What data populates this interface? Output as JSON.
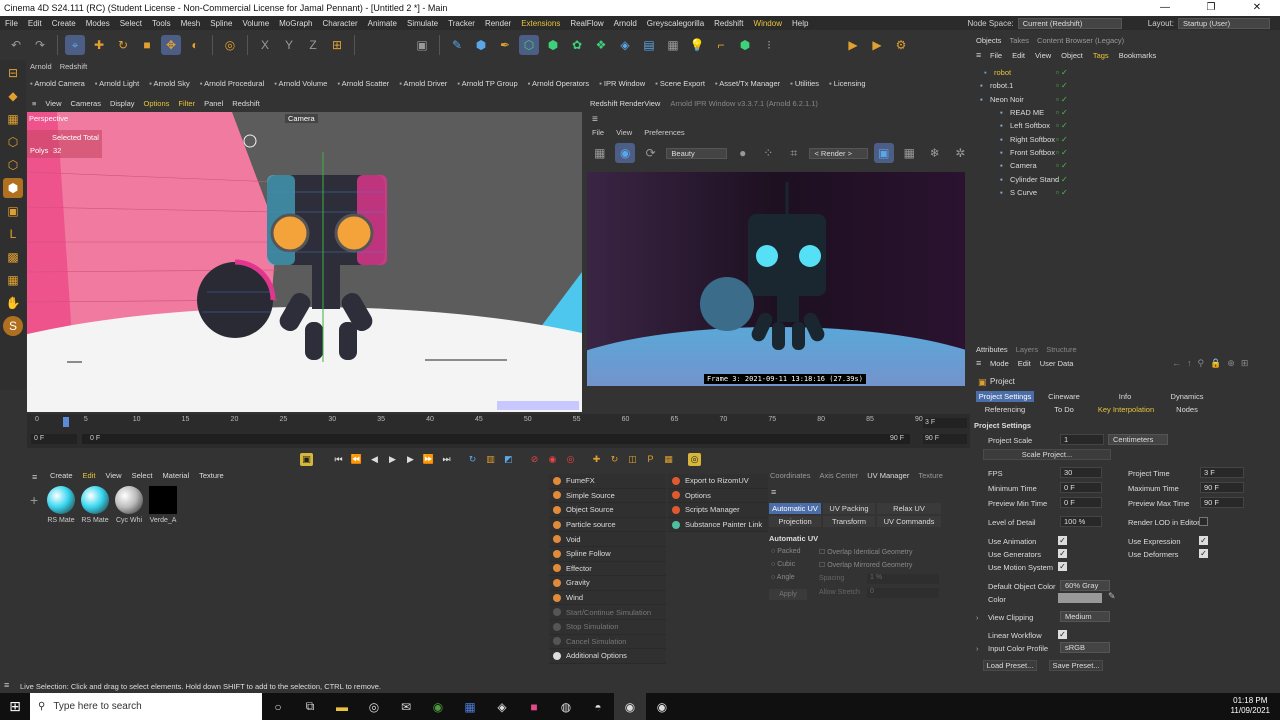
{
  "window": {
    "title": "Cinema 4D S24.111 (RC) (Student License - Non-Commercial License for Jamal Pennant) - [Untitled 2 *] - Main",
    "min": "—",
    "max": "❐",
    "close": "✕"
  },
  "menubar": {
    "items": [
      "File",
      "Edit",
      "Create",
      "Modes",
      "Select",
      "Tools",
      "Mesh",
      "Spline",
      "Volume",
      "MoGraph",
      "Character",
      "Animate",
      "Simulate",
      "Tracker",
      "Render",
      "Extensions",
      "RealFlow",
      "Arnold",
      "Greyscalegorilla",
      "Redshift",
      "Window",
      "Help"
    ],
    "node_space_label": "Node Space:",
    "node_space_value": "Current (Redshift)",
    "layout_label": "Layout:",
    "layout_value": "Startup (User)"
  },
  "arnold": {
    "tabs": [
      "Arnold",
      "Redshift"
    ],
    "items": [
      "Arnold Camera",
      "Arnold Light",
      "Arnold Sky",
      "Arnold Procedural",
      "Arnold Volume",
      "Arnold Scatter",
      "Arnold Driver",
      "Arnold TP Group",
      "Arnold Operators",
      "IPR Window",
      "Scene Export",
      "Asset/Tx Manager",
      "Utilities",
      "Licensing"
    ]
  },
  "viewport": {
    "menu": [
      "View",
      "Cameras",
      "Display",
      "Options",
      "Filter",
      "Panel",
      "Redshift"
    ],
    "label": "Perspective",
    "camera": "Camera",
    "selected_total": "Selected Total",
    "polys_label": "Polys",
    "polys_value": "32"
  },
  "renderview": {
    "title": "Redshift RenderView",
    "ipr_title": "Arnold IPR Window v3.3.7.1 (Arnold 6.2.1.1)",
    "menu": [
      "File",
      "View",
      "Preferences"
    ],
    "aov": "Beauty",
    "render_mode": "< Render >",
    "frame_label": "Frame  3:  2021-09-11  13:18:16  (27.39s)"
  },
  "timeline": {
    "ticks": [
      "0",
      "5",
      "10",
      "15",
      "20",
      "25",
      "30",
      "35",
      "40",
      "45",
      "50",
      "55",
      "60",
      "65",
      "70",
      "75",
      "80",
      "85",
      "90"
    ],
    "current_frame": "3 F",
    "start": "0 F",
    "start2": "0 F",
    "end": "90 F",
    "end2": "90 F"
  },
  "materials": {
    "menu": [
      "Create",
      "Edit",
      "View",
      "Select",
      "Material",
      "Texture"
    ],
    "items": [
      {
        "name": "RS Mate",
        "color": "#37d6ef"
      },
      {
        "name": "RS Mate",
        "color": "#37d6ef"
      },
      {
        "name": "Cyc Whi",
        "color": "#bbbbbb"
      },
      {
        "name": "Verde_A",
        "color": "#000000"
      }
    ]
  },
  "simulate": {
    "items": [
      "FumeFX",
      "Simple Source",
      "Object Source",
      "Particle source",
      "Void",
      "Spline Follow",
      "Effector",
      "Gravity",
      "Wind",
      "Start/Continue Simulation",
      "Stop Simulation",
      "Cancel Simulation",
      "Additional Options"
    ],
    "ext": [
      "Export to RizomUV",
      "Options",
      "Scripts Manager",
      "Substance Painter Link"
    ]
  },
  "uv": {
    "tabs": [
      "Coordinates",
      "Axis Center",
      "UV Manager",
      "Texture"
    ],
    "row1": [
      "Automatic UV",
      "UV Packing",
      "Relax UV"
    ],
    "row2": [
      "Projection",
      "Transform",
      "UV Commands"
    ],
    "section": "Automatic UV",
    "options": [
      "Packed",
      "Cubic",
      "Angle"
    ],
    "checks": [
      "Overlap Identical Geometry",
      "Overlap Mirrored Geometry"
    ],
    "spacing_label": "Spacing",
    "spacing_value": "1 %",
    "allow_stretch_label": "Allow Stretch",
    "allow_stretch_value": "0",
    "apply": "Apply"
  },
  "objects": {
    "tabs": [
      "Objects",
      "Takes",
      "Content Browser (Legacy)"
    ],
    "menu": [
      "File",
      "Edit",
      "View",
      "Object",
      "Tags",
      "Bookmarks"
    ],
    "items": [
      {
        "name": "robot",
        "indent": 12,
        "sel": true
      },
      {
        "name": "robot.1",
        "indent": 8,
        "sel": false
      },
      {
        "name": "Neon Noir",
        "indent": 8,
        "sel": false
      },
      {
        "name": "READ ME",
        "indent": 28,
        "sel": false
      },
      {
        "name": "Left Softbox",
        "indent": 28,
        "sel": false
      },
      {
        "name": "Right Softbox",
        "indent": 28,
        "sel": false
      },
      {
        "name": "Front Softbox",
        "indent": 28,
        "sel": false
      },
      {
        "name": "Camera",
        "indent": 28,
        "sel": false
      },
      {
        "name": "Cylinder Stand",
        "indent": 28,
        "sel": false
      },
      {
        "name": "S Curve",
        "indent": 28,
        "sel": false
      }
    ]
  },
  "attributes": {
    "tabs": [
      "Attributes",
      "Layers",
      "Structure"
    ],
    "menu": [
      "Mode",
      "Edit",
      "User Data"
    ],
    "title": "Project",
    "proj_tabs_row1": [
      "Project Settings",
      "Cineware",
      "Info",
      "Dynamics"
    ],
    "proj_tabs_row2": [
      "Referencing",
      "To Do",
      "Key Interpolation",
      "Nodes"
    ],
    "section": "Project Settings",
    "project_scale_label": "Project Scale",
    "project_scale_value": "1",
    "project_scale_unit": "Centimeters",
    "scale_project": "Scale Project...",
    "fps_label": "FPS",
    "fps_value": "30",
    "project_time_label": "Project Time",
    "project_time_value": "3 F",
    "min_time_label": "Minimum Time",
    "min_time_value": "0 F",
    "max_time_label": "Maximum Time",
    "max_time_value": "90 F",
    "prev_min_label": "Preview Min Time",
    "prev_min_value": "0 F",
    "prev_max_label": "Preview Max Time",
    "prev_max_value": "90 F",
    "lod_label": "Level of Detail",
    "lod_value": "100 %",
    "render_lod_label": "Render LOD in Editor",
    "use_animation": "Use Animation",
    "use_expression": "Use Expression",
    "use_generators": "Use Generators",
    "use_deformers": "Use Deformers",
    "use_motion": "Use Motion System",
    "default_color_label": "Default Object Color",
    "default_color_value": "60% Gray",
    "color_label": "Color",
    "view_clipping_label": "View Clipping",
    "view_clipping_value": "Medium",
    "linear_workflow": "Linear Workflow",
    "input_color_label": "Input Color Profile",
    "input_color_value": "sRGB",
    "load_preset": "Load Preset...",
    "save_preset": "Save Preset..."
  },
  "status": "Live Selection: Click and drag to select elements. Hold down SHIFT to add to the selection, CTRL to remove.",
  "taskbar": {
    "search_placeholder": "Type here to search",
    "time": "01:18 PM",
    "date": "11/09/2021"
  }
}
